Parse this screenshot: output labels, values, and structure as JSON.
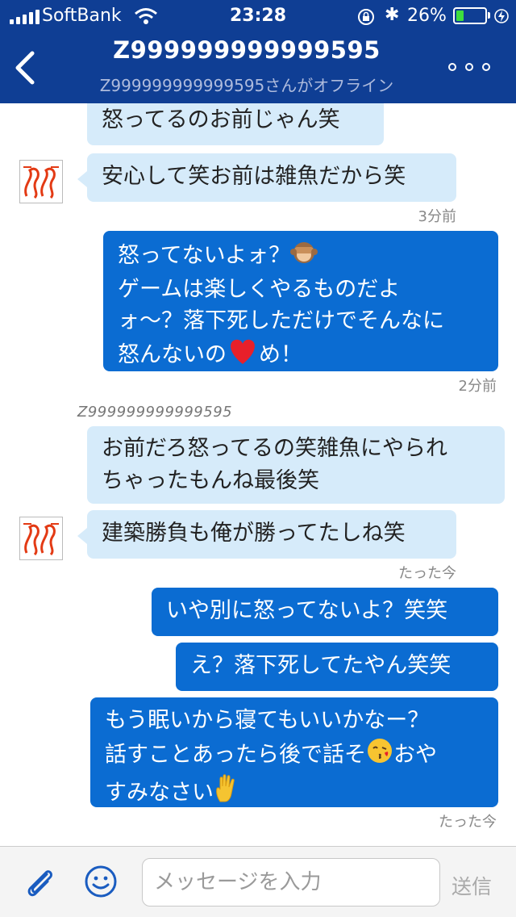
{
  "status_bar": {
    "carrier": "SoftBank",
    "time": "23:28",
    "battery": "26%",
    "battery_level": 0.26
  },
  "header": {
    "title": "Z999999999999595",
    "subtitle": "Z999999999999595さんがオフライン"
  },
  "messages": [
    {
      "side": "in",
      "text": "怒ってるのお前じゃん笑"
    },
    {
      "side": "in",
      "text": "安心して笑お前は雑魚だから笑",
      "time": "3分前"
    },
    {
      "side": "out",
      "text_lines": [
        "怒ってないよォ？",
        "ゲームは楽しくやるものだよ",
        "ォ〜？落下死しただけでそんなに",
        "怒んないの",
        "め！"
      ],
      "emoji": [
        "see-no-evil-monkey",
        "red-heart"
      ],
      "time": "2分前"
    },
    {
      "side": "in",
      "sender": "Z999999999999595",
      "text": "お前だろ怒ってるの笑雑魚にやられ\nちゃったもんね最後笑"
    },
    {
      "side": "in",
      "text": "建築勝負も俺が勝ってたしね笑",
      "time": "たった今"
    },
    {
      "side": "out",
      "text": "いや別に怒ってないよ？笑笑"
    },
    {
      "side": "out",
      "text": "え？落下死してたやん笑笑"
    },
    {
      "side": "out",
      "text_lines": [
        "もう眠いから寝てもいいかなー？",
        "話すことあったら後で話そ",
        "おや",
        "すみなさい"
      ],
      "emoji": [
        "kissing-face",
        "raised-hand"
      ],
      "time": "たった今"
    }
  ],
  "input": {
    "placeholder": "メッセージを入力",
    "send_label": "送信"
  },
  "colors": {
    "header": "#0f3e94",
    "incoming_bubble": "#d6ebfa",
    "outgoing_bubble": "#0b6cd2"
  }
}
